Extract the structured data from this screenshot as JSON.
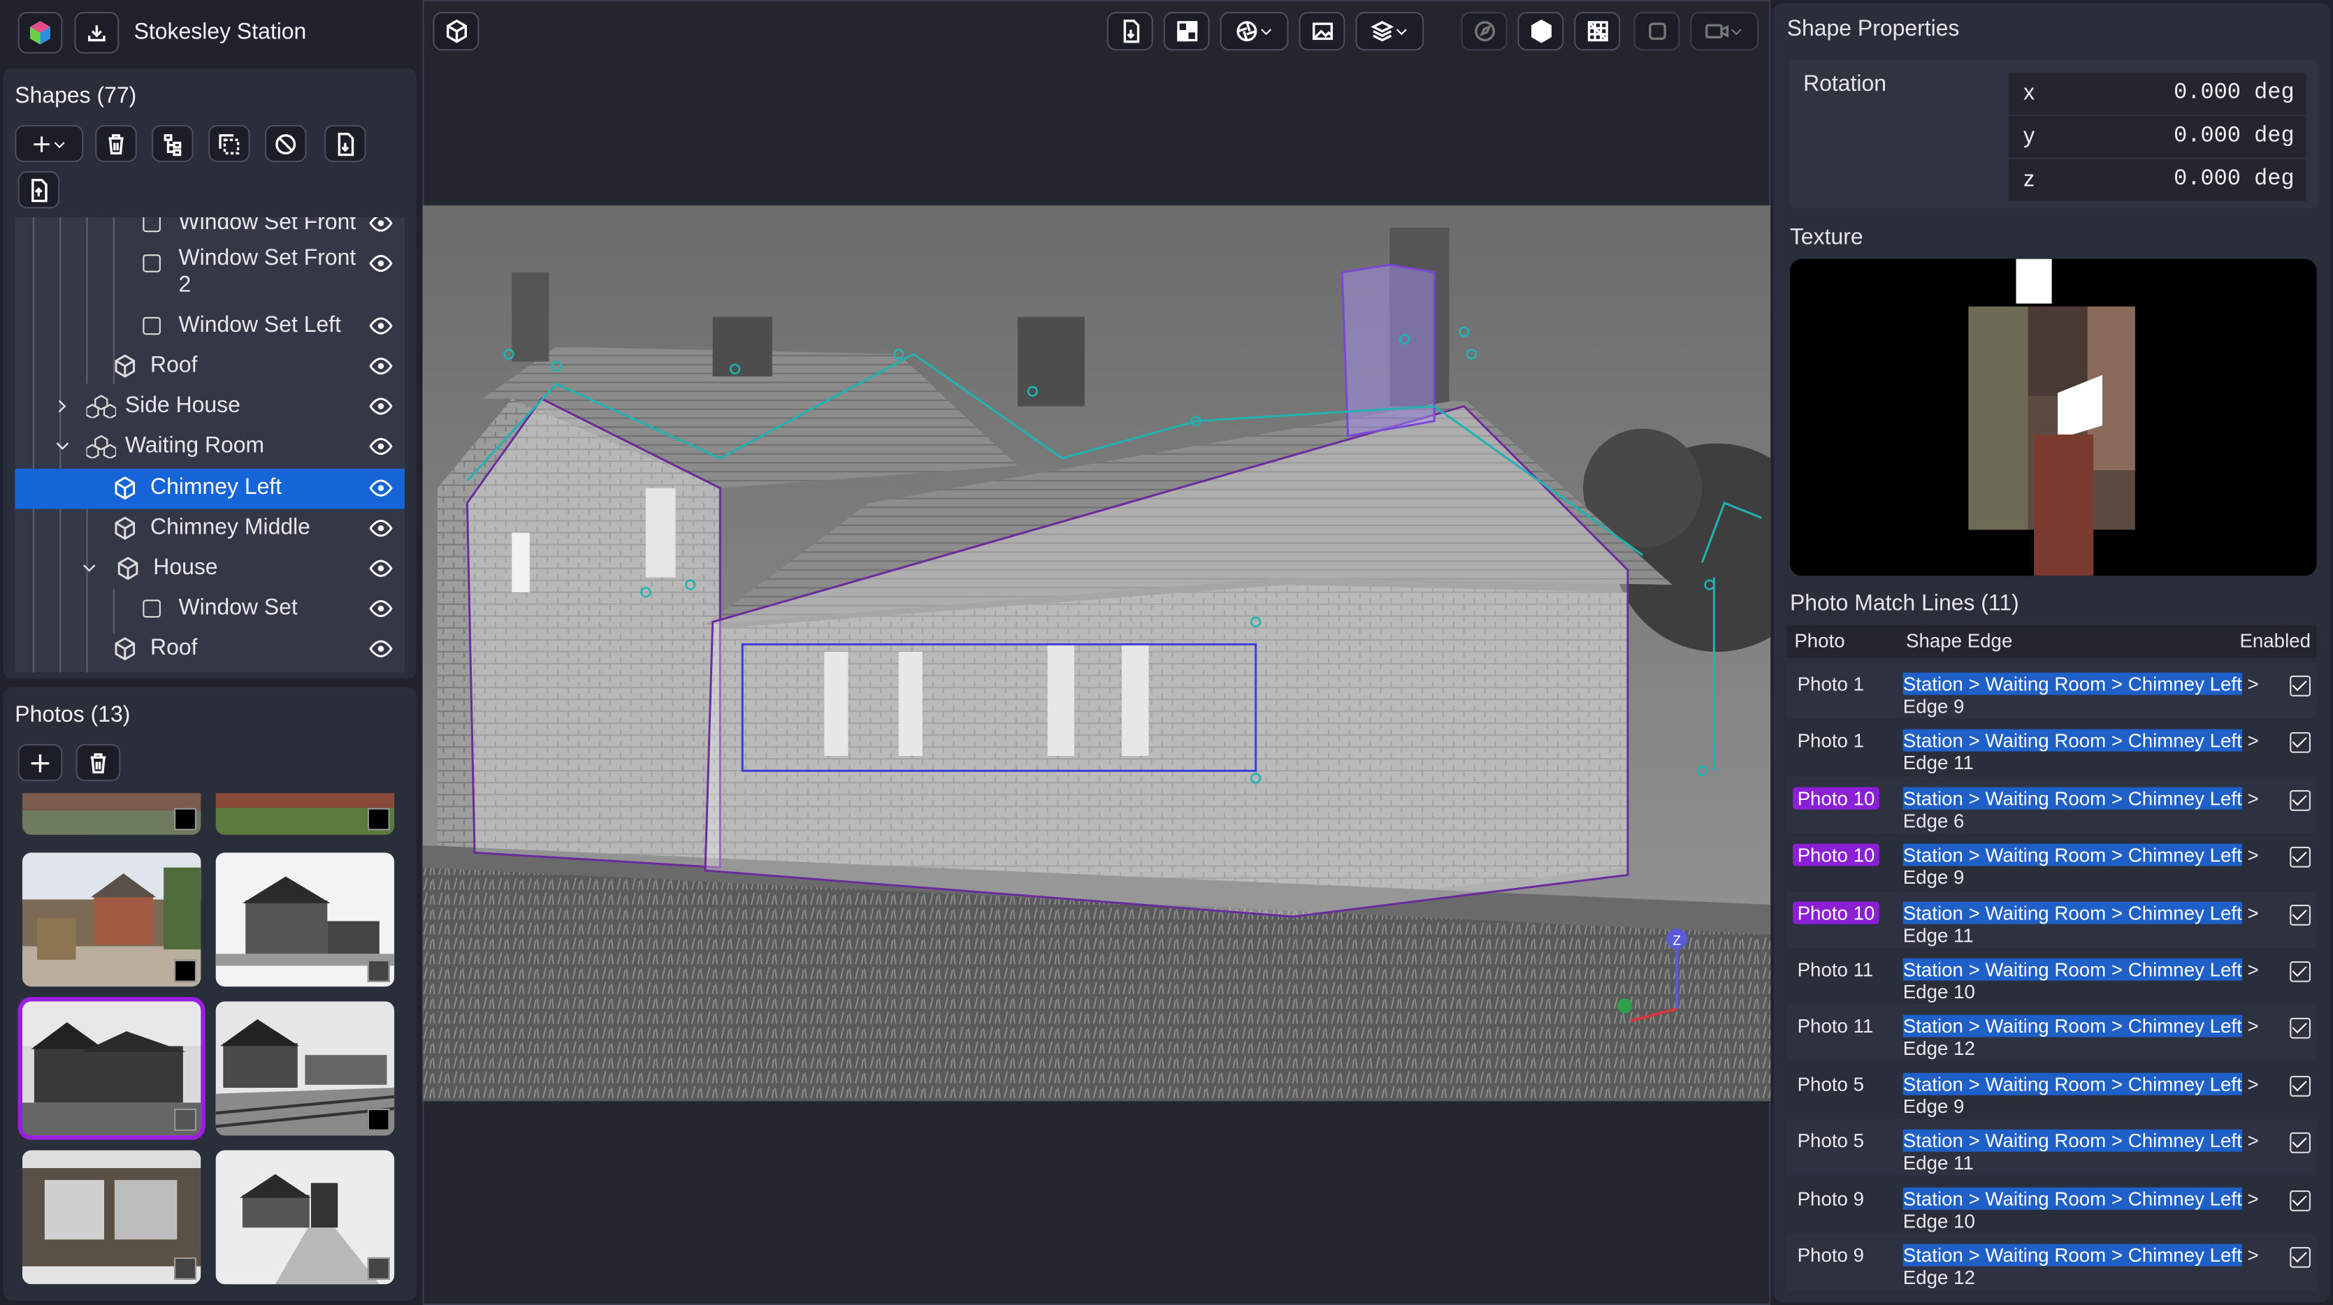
{
  "app": {
    "project_name": "Stokesley Station"
  },
  "shapes": {
    "header": "Shapes (77)",
    "tree": [
      {
        "label": "Window Set Front",
        "indent": 3,
        "type": "square"
      },
      {
        "label": "Window Set Front 2",
        "indent": 3,
        "type": "square"
      },
      {
        "label": "Window Set Left",
        "indent": 3,
        "type": "square"
      },
      {
        "label": "Roof",
        "indent": 2,
        "type": "cube"
      },
      {
        "label": "Side House",
        "indent": 1,
        "type": "group",
        "expander": "chevron-right"
      },
      {
        "label": "Waiting Room",
        "indent": 1,
        "type": "group",
        "expander": "chevron-down"
      },
      {
        "label": "Chimney Left",
        "indent": 2,
        "type": "cube",
        "selected": true
      },
      {
        "label": "Chimney Middle",
        "indent": 2,
        "type": "cube"
      },
      {
        "label": "House",
        "indent": 2,
        "type": "cube",
        "expander": "chevron-down"
      },
      {
        "label": "Window Set",
        "indent": 3,
        "type": "square"
      },
      {
        "label": "Roof",
        "indent": 2,
        "type": "cube"
      }
    ]
  },
  "photos": {
    "header": "Photos (13)"
  },
  "properties": {
    "header": "Shape Properties",
    "rotation_label": "Rotation",
    "rotation": [
      {
        "axis": "x",
        "value": "0.000 deg"
      },
      {
        "axis": "y",
        "value": "0.000 deg"
      },
      {
        "axis": "z",
        "value": "0.000 deg"
      }
    ],
    "texture_label": "Texture",
    "pml_header": "Photo Match Lines (11)",
    "pml_columns": {
      "photo": "Photo",
      "edge": "Shape Edge",
      "enabled": "Enabled"
    },
    "pml_rows": [
      {
        "photo": "Photo 1",
        "path": "Station > Waiting Room > Chimney Left",
        "edge": "Edge 9",
        "highlight": false
      },
      {
        "photo": "Photo 1",
        "path": "Station > Waiting Room > Chimney Left",
        "edge": "Edge 11",
        "highlight": false
      },
      {
        "photo": "Photo 10",
        "path": "Station > Waiting Room > Chimney Left",
        "edge": "Edge 6",
        "highlight": true
      },
      {
        "photo": "Photo 10",
        "path": "Station > Waiting Room > Chimney Left",
        "edge": "Edge 9",
        "highlight": true
      },
      {
        "photo": "Photo 10",
        "path": "Station > Waiting Room > Chimney Left",
        "edge": "Edge 11",
        "highlight": true
      },
      {
        "photo": "Photo 11",
        "path": "Station > Waiting Room > Chimney Left",
        "edge": "Edge 10",
        "highlight": false
      },
      {
        "photo": "Photo 11",
        "path": "Station > Waiting Room > Chimney Left",
        "edge": "Edge 12",
        "highlight": false
      },
      {
        "photo": "Photo 5",
        "path": "Station > Waiting Room > Chimney Left",
        "edge": "Edge 9",
        "highlight": false
      },
      {
        "photo": "Photo 5",
        "path": "Station > Waiting Room > Chimney Left",
        "edge": "Edge 11",
        "highlight": false
      },
      {
        "photo": "Photo 9",
        "path": "Station > Waiting Room > Chimney Left",
        "edge": "Edge 10",
        "highlight": false
      },
      {
        "photo": "Photo 9",
        "path": "Station > Waiting Room > Chimney Left",
        "edge": "Edge 12",
        "highlight": false
      }
    ]
  },
  "viewport": {
    "gizmo_z_label": "Z"
  },
  "colors": {
    "accent_blue": "#1565d8",
    "photo_highlight": "#8a1fd6",
    "match_line_teal": "#1fb3b3",
    "shape_outline_purple": "#7a2aa0"
  }
}
